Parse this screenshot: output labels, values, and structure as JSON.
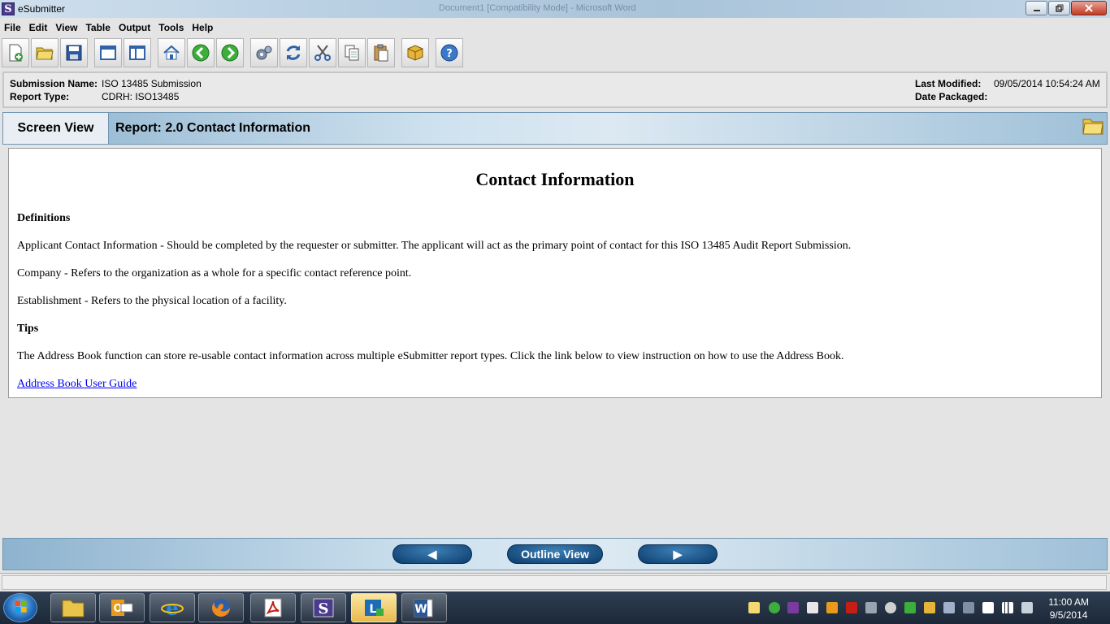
{
  "window": {
    "title": "eSubmitter",
    "app_icon_letter": "S",
    "background_title": "Document1 [Compatibility Mode] - Microsoft Word"
  },
  "menu": [
    "File",
    "Edit",
    "View",
    "Table",
    "Output",
    "Tools",
    "Help"
  ],
  "toolbar": {
    "icons": [
      "new-document-icon",
      "open-folder-icon",
      "save-icon",
      "window-icon",
      "split-view-icon",
      "home-icon",
      "back-arrow-icon",
      "forward-arrow-icon",
      "settings-icon",
      "refresh-icon",
      "cut-icon",
      "copy-icon",
      "paste-icon",
      "package-icon",
      "help-icon"
    ]
  },
  "info": {
    "submission_name_label": "Submission Name:",
    "submission_name": "ISO 13485 Submission",
    "report_type_label": "Report Type:",
    "report_type": "CDRH: ISO13485",
    "last_modified_label": "Last Modified:",
    "last_modified": "09/05/2014 10:54:24 AM",
    "date_packaged_label": "Date Packaged:",
    "date_packaged": ""
  },
  "section": {
    "view_label": "Screen View",
    "report_title": "Report: 2.0 Contact Information"
  },
  "content": {
    "heading": "Contact Information",
    "definitions_heading": "Definitions",
    "def1": "Applicant Contact Information - Should be completed by the requester or submitter. The applicant will act as the primary point of contact for this ISO 13485 Audit Report Submission.",
    "def2": "Company - Refers to the organization as a whole for a specific contact reference point.",
    "def3": "Establishment - Refers to the physical location of a facility.",
    "tips_heading": "Tips",
    "tip1": "The Address Book function can store re-usable contact information across multiple eSubmitter report types. Click the link below to view instruction on how to use the Address Book.",
    "link": "Address Book User Guide"
  },
  "nav": {
    "prev_icon": "◀",
    "outline_label": "Outline View",
    "next_icon": "▶"
  },
  "taskbar": {
    "apps": [
      "explorer",
      "outlook",
      "internet-explorer",
      "firefox",
      "acrobat",
      "esubmitter",
      "lync",
      "word"
    ],
    "time": "11:00 AM",
    "date": "9/5/2014"
  }
}
